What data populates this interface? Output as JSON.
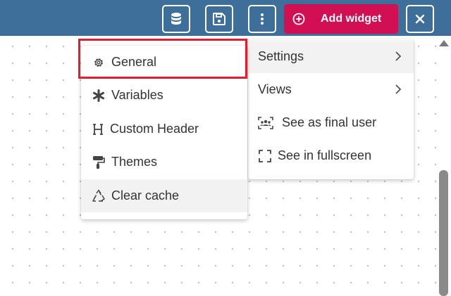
{
  "toolbar": {
    "add_widget_label": "Add widget"
  },
  "left_menu": {
    "items": [
      {
        "label": "General",
        "icon": "gear-icon"
      },
      {
        "label": "Variables",
        "icon": "asterisk-icon"
      },
      {
        "label": "Custom Header",
        "icon": "heading-icon"
      },
      {
        "label": "Themes",
        "icon": "paint-roller-icon"
      },
      {
        "label": "Clear cache",
        "icon": "recycle-icon"
      }
    ]
  },
  "right_menu": {
    "items": [
      {
        "label": "Settings",
        "icon": "chevron-right-icon"
      },
      {
        "label": "Views",
        "icon": "chevron-right-icon"
      },
      {
        "label": "See as final user",
        "icon": "users-icon"
      },
      {
        "label": "See in fullscreen",
        "icon": "expand-icon"
      }
    ]
  },
  "colors": {
    "topbar": "#3d6f9a",
    "accent": "#d20f52",
    "highlight": "#e31d2f",
    "hover_bg": "#f2f2f2"
  }
}
